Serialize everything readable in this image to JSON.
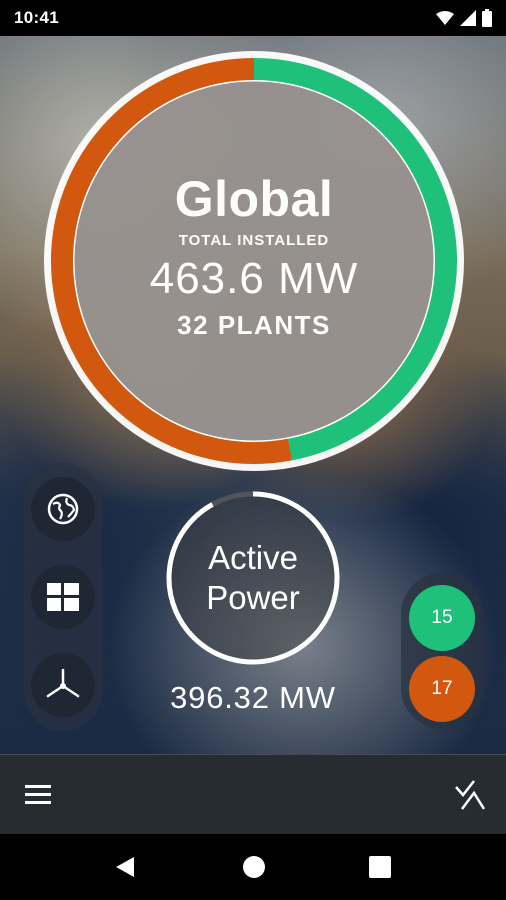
{
  "status_bar": {
    "time": "10:41",
    "icons": [
      "wifi-icon",
      "signal-icon",
      "battery-icon"
    ]
  },
  "summary": {
    "title": "Global",
    "subtitle": "TOTAL INSTALLED",
    "total_mw": "463.6 MW",
    "plants": "32 PLANTS",
    "ring_split": {
      "green_fraction": 0.47,
      "orange_fraction": 0.53
    }
  },
  "side_menu": {
    "items": [
      "globe-icon",
      "grid-icon",
      "wind-turbine-icon"
    ]
  },
  "active_power": {
    "label_line1": "Active",
    "label_line2": "Power",
    "value": "396.32 MW",
    "progress_fraction": 0.92
  },
  "plant_counts": {
    "online": "15",
    "offline": "17"
  },
  "colors": {
    "green": "#1ec07a",
    "orange": "#d2570f",
    "white": "#ffffff"
  },
  "bottom_bar": {
    "left_icon": "menu-icon",
    "right_icon": "logo-icon"
  }
}
